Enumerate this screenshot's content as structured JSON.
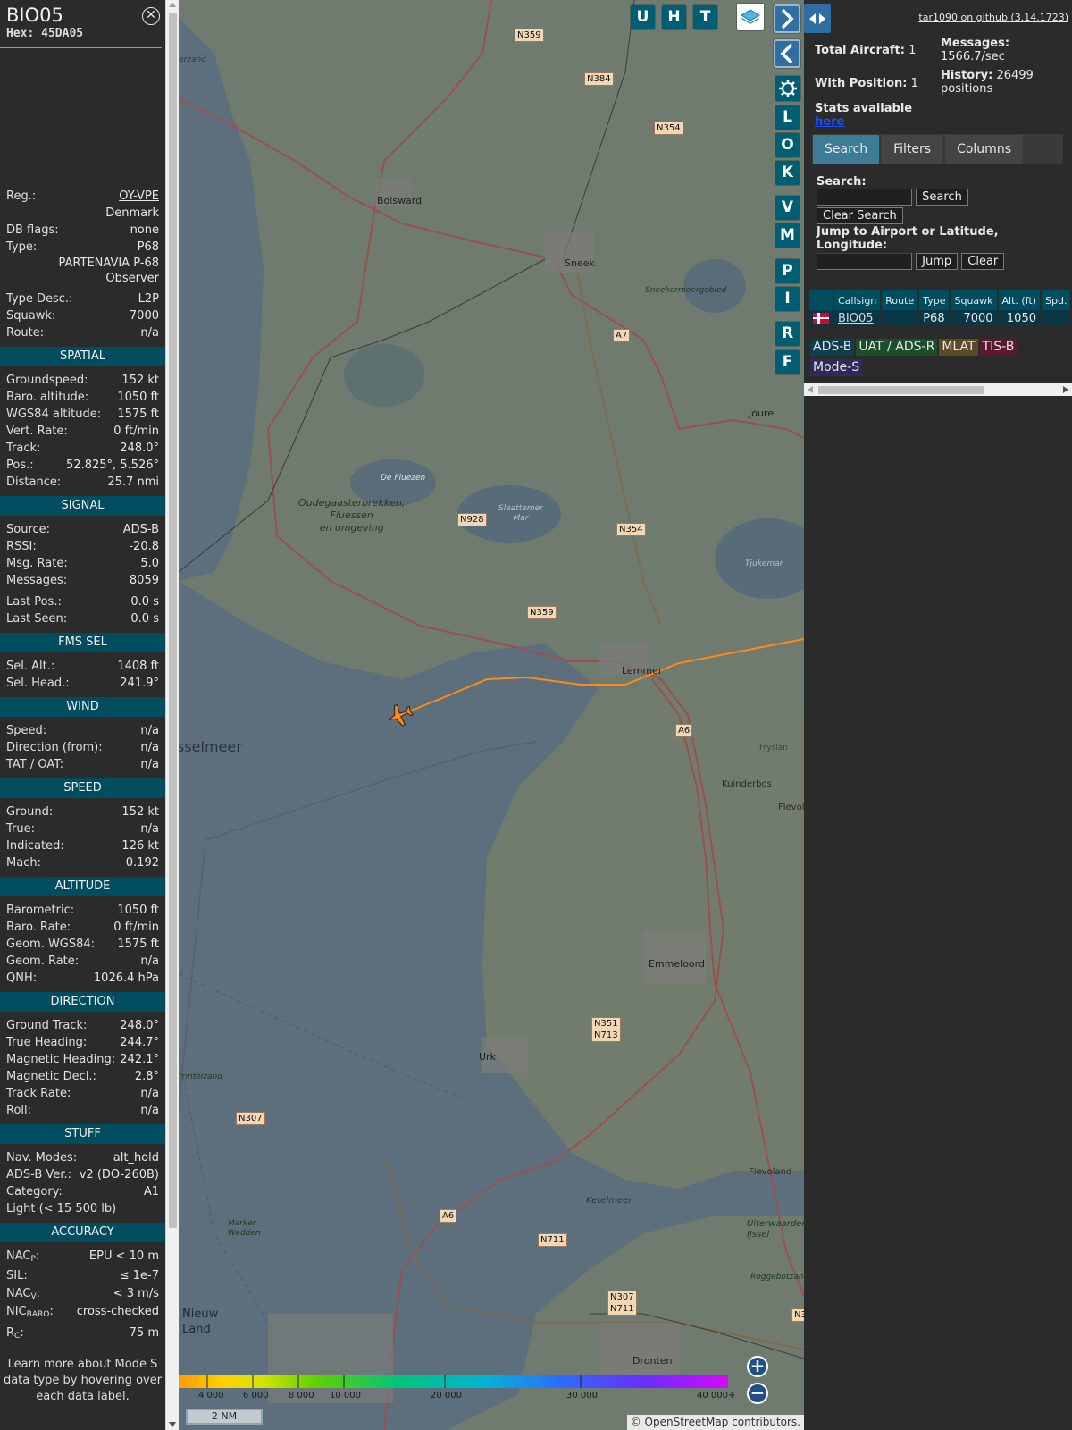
{
  "aircraft": {
    "callsign": "BIO05",
    "hex_label": "Hex:",
    "hex": "45DA05"
  },
  "info": {
    "reg_label": "Reg.:",
    "reg": "OY-VPE",
    "country": "Denmark",
    "dbflags_label": "DB flags:",
    "dbflags": "none",
    "type_label": "Type:",
    "type": "P68",
    "type_name_1": "PARTENAVIA P-68",
    "type_name_2": "Observer",
    "typedesc_label": "Type Desc.:",
    "typedesc": "L2P",
    "squawk_label": "Squawk:",
    "squawk": "7000",
    "route_label": "Route:",
    "route": "n/a"
  },
  "sections": {
    "spatial": "SPATIAL",
    "signal": "SIGNAL",
    "fms": "FMS SEL",
    "wind": "WIND",
    "speed": "SPEED",
    "altitude": "ALTITUDE",
    "direction": "DIRECTION",
    "stuff": "STUFF",
    "accuracy": "ACCURACY"
  },
  "spatial": [
    {
      "label": "Groundspeed:",
      "value": "152 kt"
    },
    {
      "label": "Baro. altitude:",
      "value": "1050 ft"
    },
    {
      "label": "WGS84 altitude:",
      "value": "1575 ft"
    },
    {
      "label": "Vert. Rate:",
      "value": "0 ft/min"
    },
    {
      "label": "Track:",
      "value": "248.0°"
    },
    {
      "label": "Pos.:",
      "value": "52.825°, 5.526°"
    },
    {
      "label": "Distance:",
      "value": "25.7 nmi"
    }
  ],
  "signal": [
    {
      "label": "Source:",
      "value": "ADS-B"
    },
    {
      "label": "RSSI:",
      "value": "-20.8"
    },
    {
      "label": "Msg. Rate:",
      "value": "5.0"
    },
    {
      "label": "Messages:",
      "value": "8059"
    },
    {
      "label": "Last Pos.:",
      "value": "0.0 s"
    },
    {
      "label": "Last Seen:",
      "value": "0.0 s"
    }
  ],
  "fms": [
    {
      "label": "Sel. Alt.:",
      "value": "1408 ft"
    },
    {
      "label": "Sel. Head.:",
      "value": "241.9°"
    }
  ],
  "wind": [
    {
      "label": "Speed:",
      "value": "n/a"
    },
    {
      "label": "Direction (from):",
      "value": "n/a"
    },
    {
      "label": "TAT / OAT:",
      "value": "n/a"
    }
  ],
  "speed": [
    {
      "label": "Ground:",
      "value": "152 kt"
    },
    {
      "label": "True:",
      "value": "n/a"
    },
    {
      "label": "Indicated:",
      "value": "126 kt"
    },
    {
      "label": "Mach:",
      "value": "0.192"
    }
  ],
  "altitude": [
    {
      "label": "Barometric:",
      "value": "1050 ft"
    },
    {
      "label": "Baro. Rate:",
      "value": "0 ft/min"
    },
    {
      "label": "Geom. WGS84:",
      "value": "1575 ft"
    },
    {
      "label": "Geom. Rate:",
      "value": "n/a"
    },
    {
      "label": "QNH:",
      "value": "1026.4 hPa"
    }
  ],
  "direction": [
    {
      "label": "Ground Track:",
      "value": "248.0°"
    },
    {
      "label": "True Heading:",
      "value": "244.7°"
    },
    {
      "label": "Magnetic Heading:",
      "value": "242.1°"
    },
    {
      "label": "Magnetic Decl.:",
      "value": "2.8°"
    },
    {
      "label": "Track Rate:",
      "value": "n/a"
    },
    {
      "label": "Roll:",
      "value": "n/a"
    }
  ],
  "stuff": {
    "navmodes_label": "Nav. Modes:",
    "navmodes": "alt_hold",
    "adsbver_label": "ADS-B Ver.:",
    "adsbver": "v2 (DO-260B)",
    "category_label": "Category:",
    "category": "A1",
    "category_desc": "Light (< 15 500 lb)"
  },
  "accuracy": {
    "nacp_label": "NAC",
    "nacp_sub": "P",
    "nacp": "EPU < 10 m",
    "sil_label": "SIL:",
    "sil": "≤ 1e-7",
    "nacv_label": "NAC",
    "nacv_sub": "V",
    "nacv": "< 3 m/s",
    "nicbaro_label": "NIC",
    "nicbaro_sub": "BARO",
    "nicbaro": "cross-checked",
    "rc_label": "R",
    "rc_sub": "C",
    "rc": "75 m"
  },
  "footer_note": "Learn more about Mode S data type by hovering over each data label.",
  "map": {
    "buttons_top": [
      "U",
      "H",
      "T"
    ],
    "buttons_side": [
      "L",
      "O",
      "K",
      "V",
      "M",
      "P",
      "I",
      "R",
      "F"
    ],
    "legend_labels": [
      "4 000",
      "6 000",
      "8 000",
      "10 000",
      "20 000",
      "30 000",
      "40 000+"
    ],
    "scale": "2 NM",
    "attribution_prefix": "© ",
    "attribution_link": "OpenStreetMap",
    "attribution_suffix": " contributors.",
    "places": {
      "bolsward": "Bolsward",
      "sneek": "Sneek",
      "joure": "Joure",
      "lemmer": "Lemmer",
      "emmeloord": "Emmeloord",
      "urk": "Urk",
      "dronten": "Dronten",
      "ijsselmeer": "sselmeer",
      "ketelmeer": "Ketelmeer",
      "flevoland": "Flevoland",
      "nieuw_land": "Nieuw\nLand",
      "kuinderbos": "Kuinderbos",
      "sneekermeer": "Sneekermeergebied",
      "fluezen": "De Fluezen",
      "slotermeer": "Sleattemer\nMar",
      "tjukemar": "Tjukemar",
      "oudegaaster": "Oudegaasterbrekken,\nFluessen\nen omgeving",
      "trintelzand": "Trintelzand",
      "marker_wadden": "Marker\nWadden",
      "uiterwaarden": "Uiterwaarden\nIJssel",
      "roggebotzand": "Roggebotzand",
      "flevol_edge": "Flevol",
      "frysian": "Fryslân",
      "erzand": "erzand"
    },
    "shields": [
      "N359",
      "N384",
      "N354",
      "A7",
      "N928",
      "N354",
      "N359",
      "A6",
      "N351\nN713",
      "N307",
      "A6",
      "N711",
      "N307\nN711",
      "N3"
    ]
  },
  "right": {
    "github": "tar1090 on github (3.14.1723)",
    "total_label": "Total Aircraft:",
    "total": "1",
    "messages_label": "Messages:",
    "messages": "1566.7/sec",
    "withpos_label": "With Position:",
    "withpos": "1",
    "history_label": "History:",
    "history": "26499 positions",
    "stats_text": "Stats available",
    "stats_link": "here",
    "tabs": [
      "Search",
      "Filters",
      "Columns"
    ],
    "search_label": "Search:",
    "search_button": "Search",
    "clear_search": "Clear Search",
    "jump_label": "Jump to Airport or Latitude, Longitude:",
    "jump_button": "Jump",
    "clear_button": "Clear",
    "columns": [
      "",
      "Callsign",
      "Route",
      "Type",
      "Squawk",
      "Alt. (ft)",
      "Spd."
    ],
    "rows": [
      {
        "callsign": "BIO05",
        "route": "",
        "type": "P68",
        "squawk": "7000",
        "alt": "1050",
        "spd": ""
      }
    ],
    "sources": [
      {
        "label": "ADS-B",
        "color": "#123d4f"
      },
      {
        "label": "UAT / ADS-R",
        "color": "#1a4e2d"
      },
      {
        "label": "MLAT",
        "color": "#5b4a25"
      },
      {
        "label": "TIS-B",
        "color": "#5a1b31"
      },
      {
        "label": "Mode-S",
        "color": "#2e2a5e"
      }
    ]
  }
}
